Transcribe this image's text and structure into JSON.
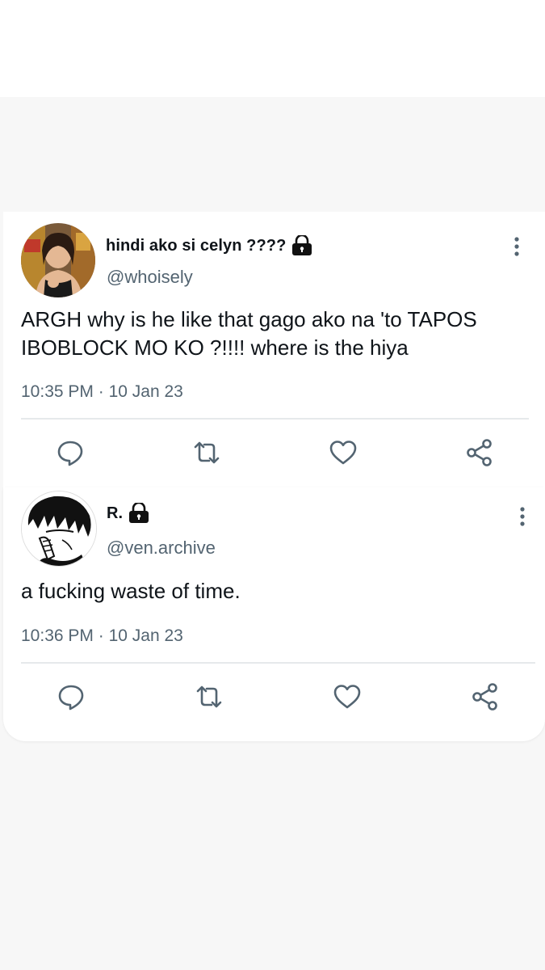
{
  "tweets": [
    {
      "display_name": "hindi ako si celyn ????",
      "handle": "@whoisely",
      "text_line1": "ARGH why is he like that gago ako na 'to TAPOS",
      "text_line2": "IBOBLOCK MO KO ?!!!! where is the hiya",
      "time": "10:35 PM",
      "date": "10 Jan 23",
      "locked": true
    },
    {
      "display_name": "R.",
      "handle": "@ven.archive",
      "text_line1": "a fucking waste of time.",
      "time": "10:36 PM",
      "date": "10 Jan 23",
      "locked": true
    }
  ],
  "separator": "·",
  "icons": [
    "lock-icon",
    "more-vertical-icon",
    "reply-icon",
    "retweet-icon",
    "like-icon",
    "share-icon"
  ],
  "colors": {
    "text": "#0f1419",
    "secondary": "#536471",
    "divider": "#e6e9eb",
    "background": "#f7f7f7",
    "card": "#ffffff"
  }
}
